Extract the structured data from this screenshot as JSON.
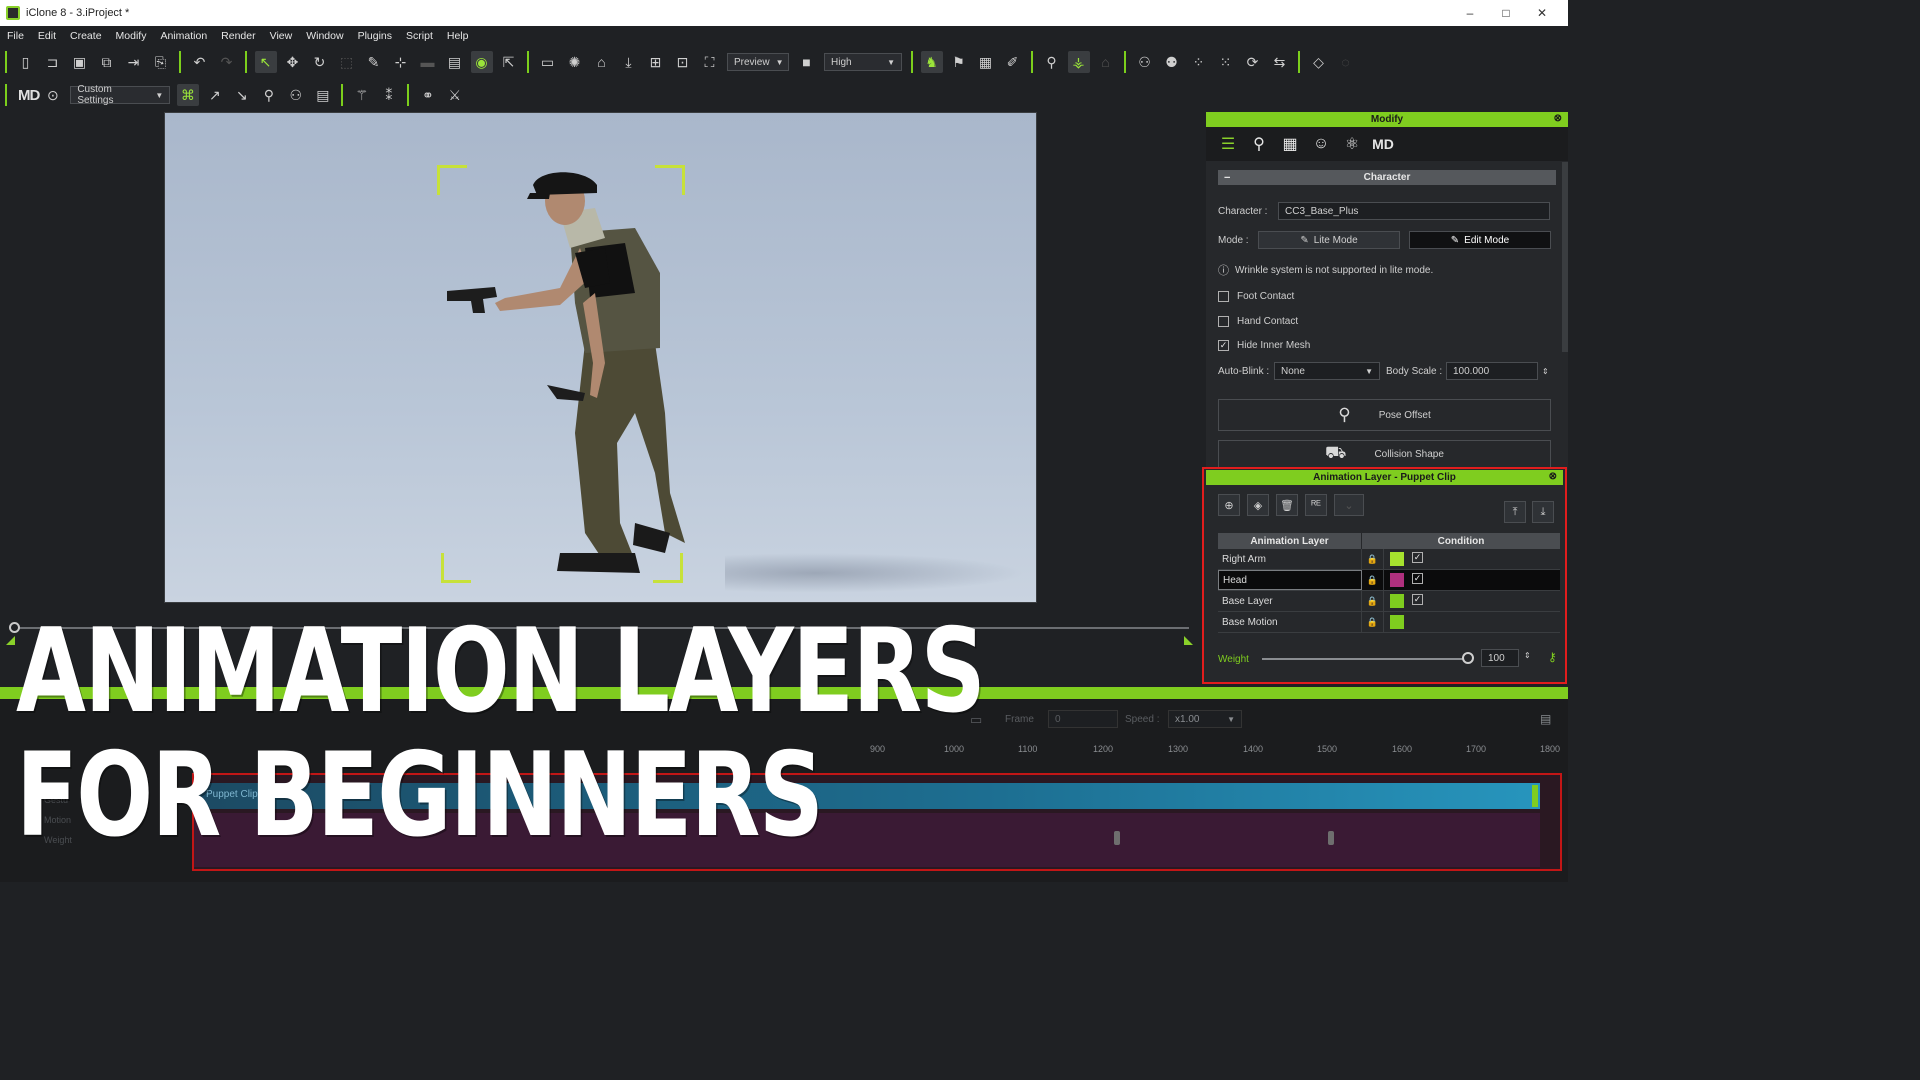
{
  "window": {
    "title": "iClone 8 - 3.iProject *",
    "controls": [
      "–",
      "□",
      "✕"
    ]
  },
  "menu": [
    "File",
    "Edit",
    "Create",
    "Modify",
    "Animation",
    "Render",
    "View",
    "Window",
    "Plugins",
    "Script",
    "Help"
  ],
  "toolbar": {
    "preview_select": "Preview",
    "quality_select": "High",
    "custom_settings": "Custom Settings",
    "md_logo": "MD"
  },
  "modify_panel": {
    "header": "Modify",
    "tabs": [
      "sliders",
      "pose",
      "checker",
      "face",
      "physics",
      "MD"
    ],
    "section": "Character",
    "character_label": "Character :",
    "character_value": "CC3_Base_Plus",
    "mode_label": "Mode :",
    "lite_mode": "Lite Mode",
    "edit_mode": "Edit Mode",
    "info_text": "Wrinkle system is not supported in lite mode.",
    "foot_contact": "Foot Contact",
    "hand_contact": "Hand Contact",
    "hide_inner_mesh": "Hide Inner Mesh",
    "auto_blink_label": "Auto-Blink :",
    "auto_blink_value": "None",
    "body_scale_label": "Body Scale :",
    "body_scale_value": "100.000",
    "pose_offset": "Pose Offset",
    "collision_shape": "Collision Shape"
  },
  "layer_panel": {
    "header": "Animation Layer - Puppet Clip",
    "col_layer": "Animation Layer",
    "col_condition": "Condition",
    "rows": [
      {
        "name": "Right Arm",
        "color": "#a6e22e",
        "checked": true,
        "selected": false
      },
      {
        "name": "Head",
        "color": "#b0307e",
        "checked": true,
        "selected": true
      },
      {
        "name": "Base Layer",
        "color": "#7fcd1f",
        "checked": true,
        "selected": false
      },
      {
        "name": "Base Motion",
        "color": "#7fcd1f",
        "checked": false,
        "selected": false
      }
    ],
    "weight_label": "Weight",
    "weight_value": "100"
  },
  "timeline": {
    "frame_label": "Frame",
    "frame_value": "0",
    "speed_label": "Speed :",
    "speed_value": "x1.00",
    "ruler": [
      "900",
      "1000",
      "1100",
      "1200",
      "1300",
      "1400",
      "1500",
      "1600",
      "1700",
      "1800"
    ],
    "clip_label": "Puppet Clip",
    "track_labels": [
      "Gestu",
      "Motion",
      "Weight"
    ]
  },
  "headline": {
    "line1": "ANIMATION LAYERS",
    "line2": "FOR BEGINNERS"
  },
  "colors": {
    "accent_green": "#7fcd1f",
    "highlight_red": "#e11d1d",
    "head_magenta": "#b0307e"
  }
}
